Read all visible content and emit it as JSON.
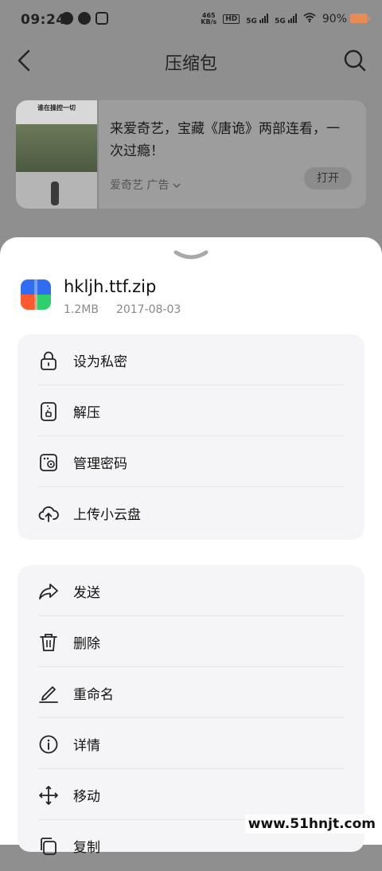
{
  "status_bar": {
    "time": "09:24",
    "net_speed_top": "465",
    "net_speed_unit": "KB/s",
    "hd_label": "HD",
    "sim1_label": "5G",
    "sim2_label": "5G",
    "battery": "90%"
  },
  "header": {
    "title": "压缩包",
    "back_icon": "chevron-left-icon",
    "search_icon": "search-icon"
  },
  "ad": {
    "thumb_caption": "谁在操控一切",
    "text": "来爱奇艺，宝藏《唐诡》两部连看，一次过瘾！",
    "source": "爱奇艺  广告",
    "open_label": "打开"
  },
  "file": {
    "name": "hkljh.ttf.zip",
    "size": "1.2MB",
    "date": "2017-08-03"
  },
  "actions_primary": [
    {
      "label": "设为私密",
      "icon": "lock-icon"
    },
    {
      "label": "解压",
      "icon": "unzip-icon"
    },
    {
      "label": "管理密码",
      "icon": "password-manage-icon"
    },
    {
      "label": "上传小云盘",
      "icon": "cloud-upload-icon"
    }
  ],
  "actions_secondary": [
    {
      "label": "发送",
      "icon": "share-icon"
    },
    {
      "label": "删除",
      "icon": "trash-icon"
    },
    {
      "label": "重命名",
      "icon": "pencil-icon"
    },
    {
      "label": "详情",
      "icon": "info-icon"
    },
    {
      "label": "移动",
      "icon": "move-icon"
    },
    {
      "label": "复制",
      "icon": "copy-icon"
    }
  ],
  "watermark": "www.51hnjt.com",
  "colors": {
    "overlay": "#8f8f8f",
    "sheet": "#ffffff",
    "group_bg": "#f5f5f7",
    "battery": "#e98b54"
  }
}
